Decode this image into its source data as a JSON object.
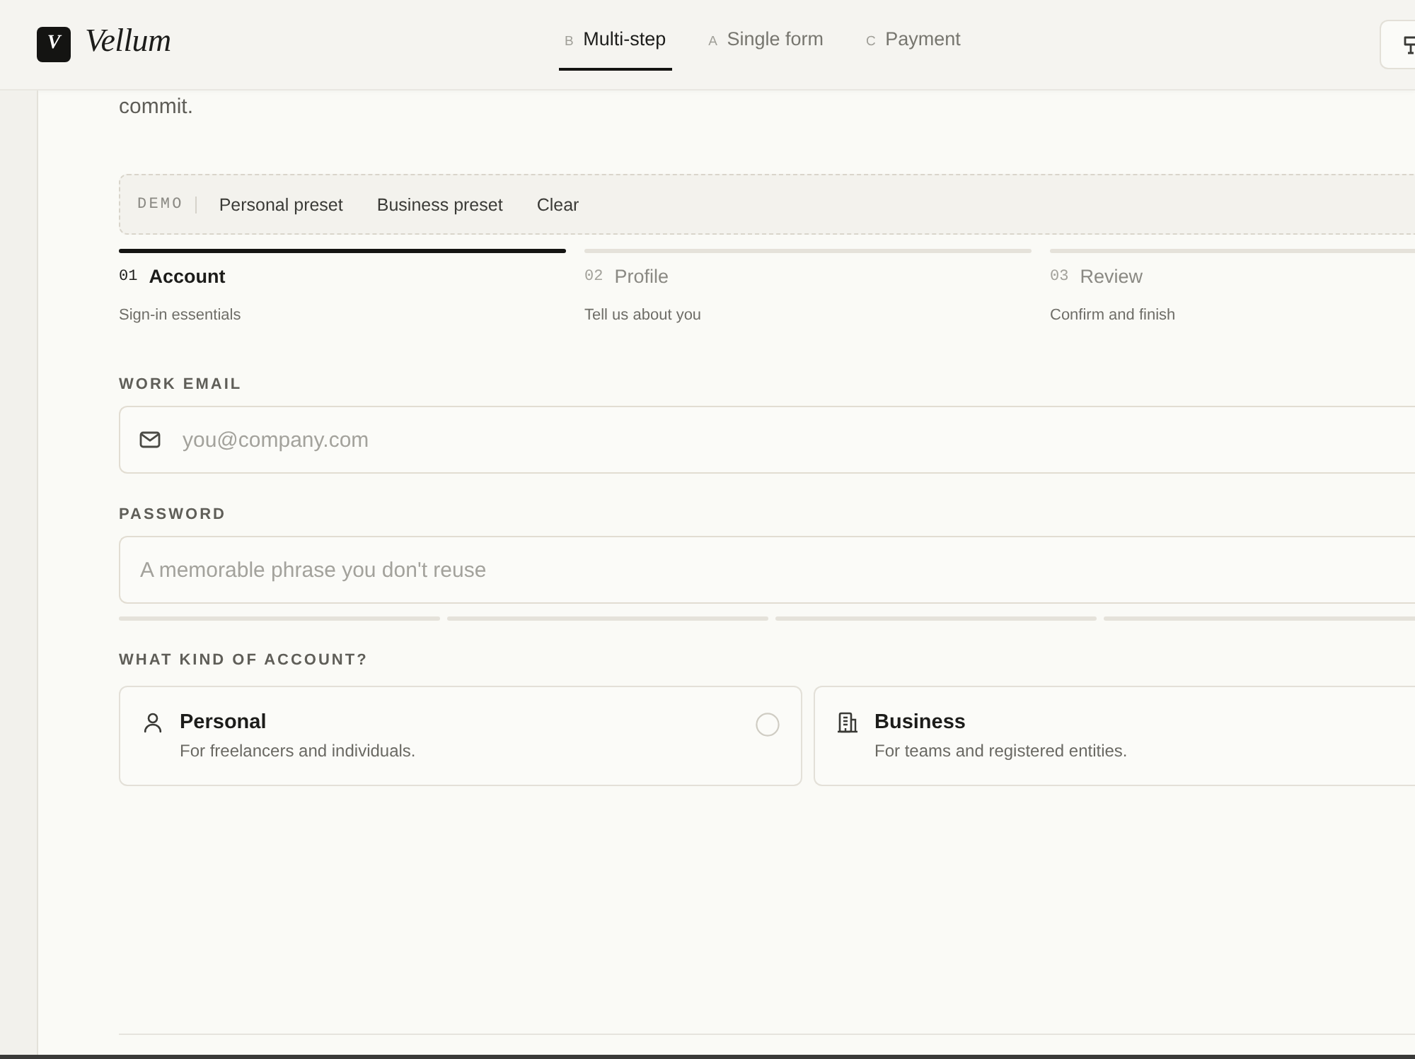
{
  "header": {
    "logo_mark": "V",
    "brand": "Vellum",
    "tabs": [
      {
        "key": "B",
        "label": "Multi-step",
        "selected": true
      },
      {
        "key": "A",
        "label": "Single form",
        "selected": false
      },
      {
        "key": "C",
        "label": "Payment",
        "selected": false
      }
    ]
  },
  "intro_text": "commit.",
  "demo_bar": {
    "label": "DEMO",
    "actions": [
      "Personal preset",
      "Business preset",
      "Clear"
    ]
  },
  "steps": [
    {
      "number": "01",
      "title": "Account",
      "subtitle": "Sign-in essentials",
      "selected": true
    },
    {
      "number": "02",
      "title": "Profile",
      "subtitle": "Tell us about you",
      "selected": false
    },
    {
      "number": "03",
      "title": "Review",
      "subtitle": "Confirm and finish",
      "selected": false
    }
  ],
  "fields": [
    {
      "kind": "email",
      "label": "WORK EMAIL",
      "placeholder": "you@company.com"
    },
    {
      "kind": "password",
      "label": "PASSWORD",
      "placeholder": "A memorable phrase you don't reuse"
    }
  ],
  "password_strength": [
    {
      "filled": false
    },
    {
      "filled": false
    },
    {
      "filled": false
    },
    {
      "filled": false
    }
  ],
  "account_type": {
    "label": "WHAT KIND OF ACCOUNT?",
    "options": [
      {
        "kind": "personal",
        "title": "Personal",
        "description": "For freelancers and individuals.",
        "selected": false
      },
      {
        "kind": "business",
        "title": "Business",
        "description": "For teams and registered entities.",
        "selected": false
      }
    ]
  }
}
